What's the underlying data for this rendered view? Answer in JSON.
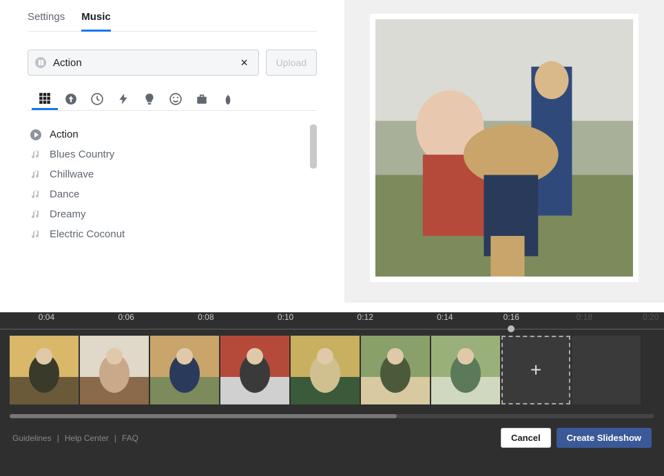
{
  "tabs": {
    "settings": "Settings",
    "music": "Music",
    "active": "music"
  },
  "search": {
    "value": "Action"
  },
  "upload_label": "Upload",
  "music_list": [
    {
      "label": "Action",
      "playing": true
    },
    {
      "label": "Blues Country",
      "playing": false
    },
    {
      "label": "Chillwave",
      "playing": false
    },
    {
      "label": "Dance",
      "playing": false
    },
    {
      "label": "Dreamy",
      "playing": false
    },
    {
      "label": "Electric Coconut",
      "playing": false
    }
  ],
  "timeline": {
    "ticks": [
      {
        "label": "0:04",
        "left_pct": 7,
        "dim": false
      },
      {
        "label": "0:06",
        "left_pct": 19,
        "dim": false
      },
      {
        "label": "0:08",
        "left_pct": 31,
        "dim": false
      },
      {
        "label": "0:10",
        "left_pct": 43,
        "dim": false
      },
      {
        "label": "0:12",
        "left_pct": 55,
        "dim": false
      },
      {
        "label": "0:14",
        "left_pct": 67,
        "dim": false
      },
      {
        "label": "0:16",
        "left_pct": 77,
        "dim": false
      },
      {
        "label": "0:18",
        "left_pct": 88,
        "dim": true
      },
      {
        "label": "0:20",
        "left_pct": 98,
        "dim": true
      }
    ],
    "knob_left_pct": 77
  },
  "footer": {
    "links": [
      "Guidelines",
      "Help Center",
      "FAQ"
    ],
    "cancel": "Cancel",
    "create": "Create Slideshow"
  },
  "thumbnails_count": 7
}
